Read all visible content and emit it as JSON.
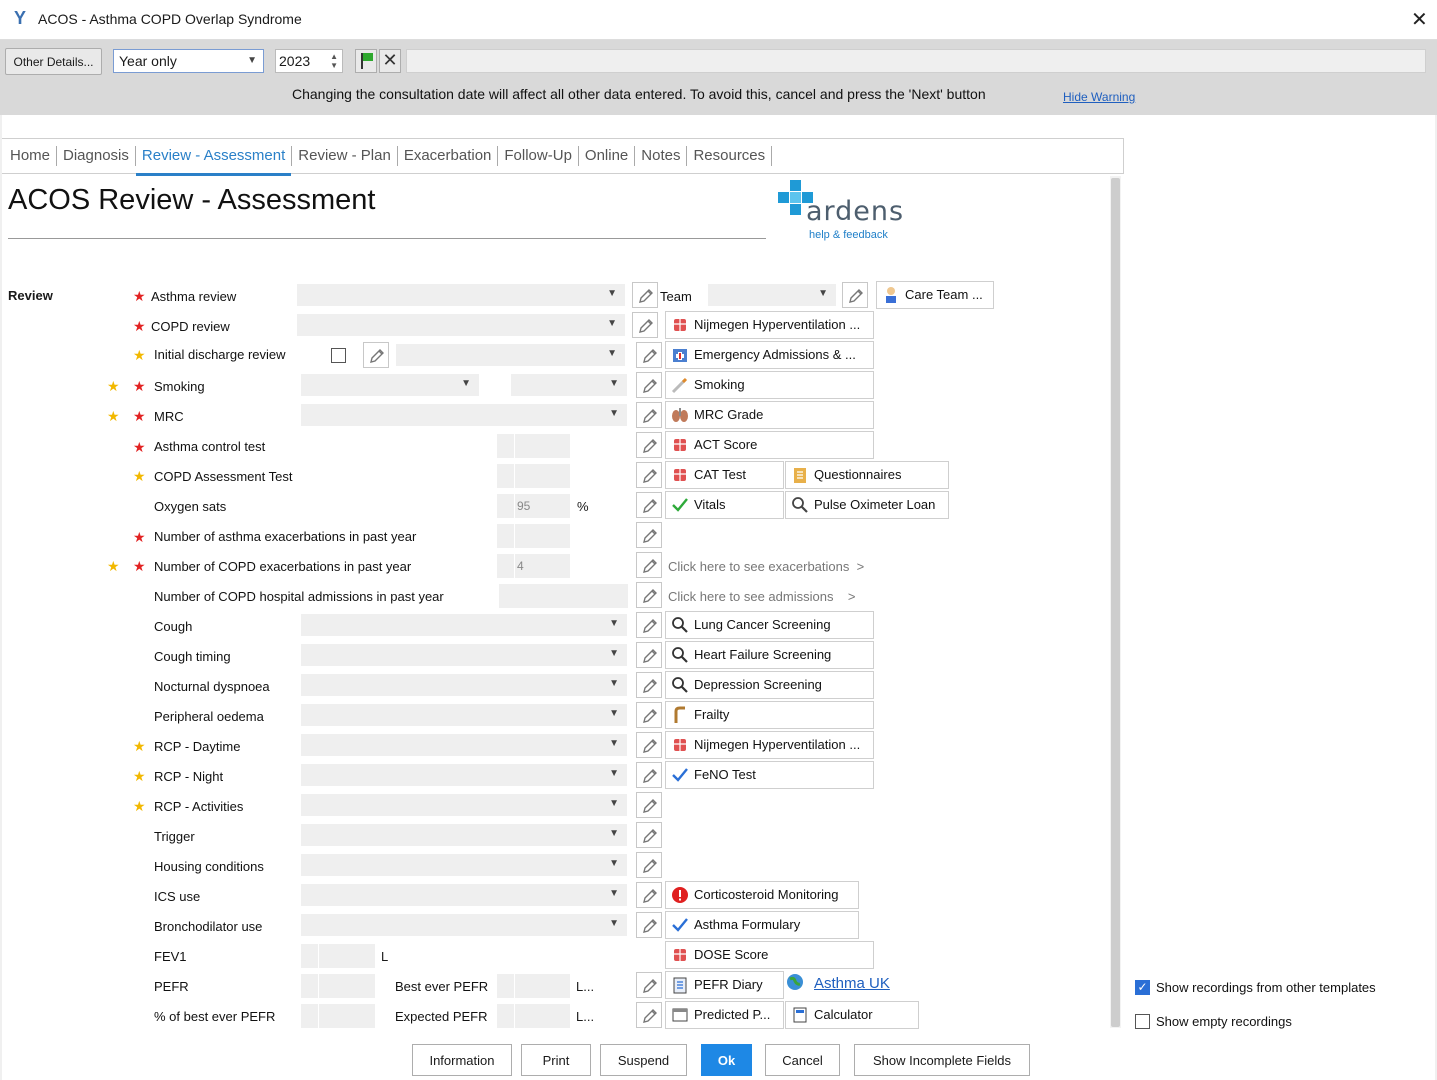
{
  "window": {
    "title": "ACOS - Asthma COPD Overlap Syndrome"
  },
  "toolbar": {
    "other_details": "Other Details...",
    "date_mode": "Year only",
    "year": "2023",
    "warning": "Changing the consultation date will affect all other data entered. To avoid this, cancel and press the 'Next' button",
    "hide_warning": "Hide Warning"
  },
  "tabs": [
    "Home",
    "Diagnosis",
    "Review - Assessment",
    "Review - Plan",
    "Exacerbation",
    "Follow-Up",
    "Online",
    "Notes",
    "Resources"
  ],
  "active_tab": "Review - Assessment",
  "page": {
    "title": "ACOS Review - Assessment",
    "section": "Review"
  },
  "brand": {
    "name": "ardens",
    "help": "help & feedback"
  },
  "fields": {
    "asthma_review": "Asthma review",
    "copd_review": "COPD review",
    "initial_discharge": "Initial discharge review",
    "smoking": "Smoking",
    "mrc": "MRC",
    "act": "Asthma control test",
    "cat": "COPD Assessment Test",
    "oxygen": "Oxygen sats",
    "oxygen_value": "95",
    "oxygen_unit": "%",
    "asthma_exac": "Number of asthma exacerbations in past year",
    "copd_exac": "Number of COPD exacerbations in past year",
    "copd_exac_value": "4",
    "copd_hosp": "Number of COPD hospital admissions in past year",
    "cough": "Cough",
    "cough_timing": "Cough timing",
    "nocturnal": "Nocturnal dyspnoea",
    "peripheral": "Peripheral oedema",
    "rcp_day": "RCP - Daytime",
    "rcp_night": "RCP - Night",
    "rcp_act": "RCP - Activities",
    "trigger": "Trigger",
    "housing": "Housing conditions",
    "ics": "ICS use",
    "broncho": "Bronchodilator use",
    "fev1": "FEV1",
    "fev1_unit": "L",
    "pefr": "PEFR",
    "best_pefr": "Best ever PEFR",
    "best_pefr_unit": "L...",
    "pct_best": "% of best ever PEFR",
    "expected_pefr": "Expected PEFR",
    "expected_pefr_unit": "L..."
  },
  "team": {
    "label": "Team",
    "care_team": "Care Team ..."
  },
  "links": {
    "nijmegen1": "Nijmegen Hyperventilation ...",
    "emergency": "Emergency Admissions & ...",
    "smoking": "Smoking",
    "mrc_grade": "MRC Grade",
    "act_score": "ACT Score",
    "cat_test": "CAT Test",
    "questionnaires": "Questionnaires",
    "vitals": "Vitals",
    "pulse_ox": "Pulse Oximeter Loan",
    "see_exac": "Click here to see exacerbations",
    "see_adm": "Click here to see admissions",
    "lung": "Lung Cancer Screening",
    "heart": "Heart Failure Screening",
    "depression": "Depression Screening",
    "frailty": "Frailty",
    "nijmegen2": "Nijmegen Hyperventilation ...",
    "feno": "FeNO Test",
    "cortico": "Corticosteroid Monitoring",
    "formulary": "Asthma Formulary",
    "dose": "DOSE Score",
    "pefr_diary": "PEFR Diary",
    "asthma_uk": "Asthma UK",
    "predicted": "Predicted P...",
    "calculator": "Calculator"
  },
  "options": {
    "show_other": "Show recordings from other templates",
    "show_other_checked": true,
    "show_empty": "Show empty recordings",
    "show_empty_checked": false
  },
  "buttons": {
    "information": "Information",
    "print": "Print",
    "suspend": "Suspend",
    "ok": "Ok",
    "cancel": "Cancel",
    "incomplete": "Show Incomplete Fields"
  },
  "colors": {
    "accent": "#2a80c8",
    "required_star": "#e22222",
    "optional_star": "#f2b800"
  }
}
